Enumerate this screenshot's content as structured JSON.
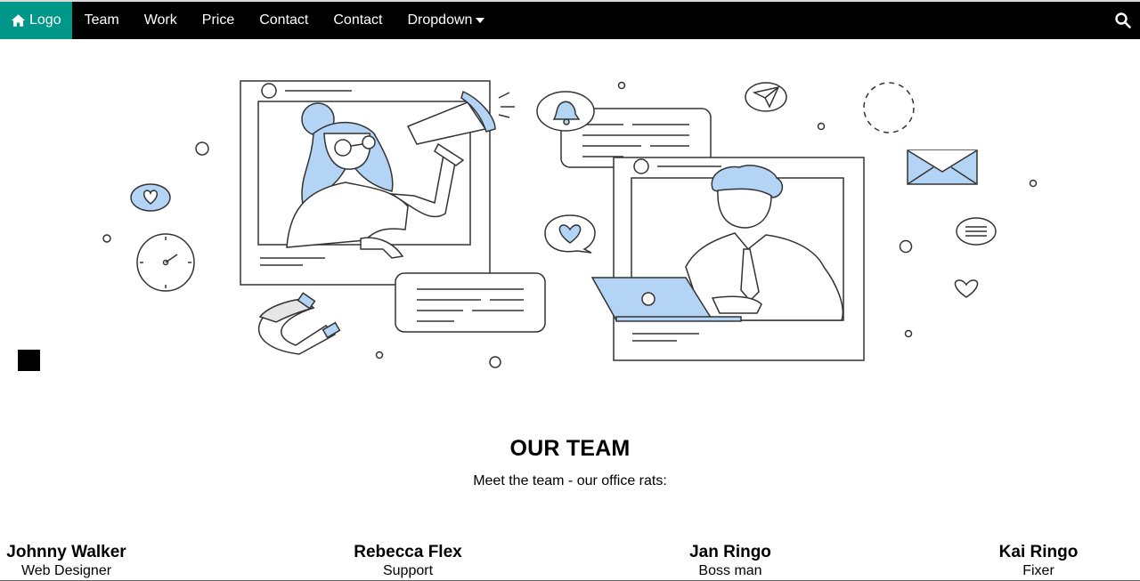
{
  "navbar": {
    "items": [
      {
        "label": "Logo",
        "icon": "home-icon",
        "active_color": "#009688"
      },
      {
        "label": "Team"
      },
      {
        "label": "Work"
      },
      {
        "label": "Price"
      },
      {
        "label": "Contact"
      },
      {
        "label": "Contact"
      },
      {
        "label": "Dropdown",
        "icon": "caret-down-icon"
      }
    ],
    "search_icon": "search-icon",
    "background": "#000000"
  },
  "hero": {
    "illustration": "team-communication-illustration",
    "accent_color": "#b3d4f5"
  },
  "team": {
    "title": "OUR TEAM",
    "subtitle": "Meet the team - our office rats:",
    "members": [
      {
        "name": "Johnny Walker",
        "role": "Web Designer"
      },
      {
        "name": "Rebecca Flex",
        "role": "Support"
      },
      {
        "name": "Jan Ringo",
        "role": "Boss man"
      },
      {
        "name": "Kai Ringo",
        "role": "Fixer"
      }
    ]
  }
}
